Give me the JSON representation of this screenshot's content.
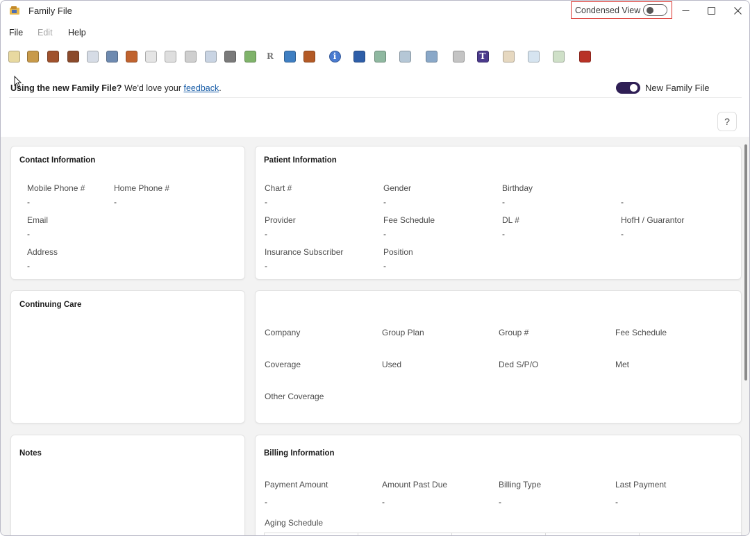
{
  "window": {
    "title": "Family File",
    "condensed_view": {
      "label": "Condensed View",
      "on": false
    },
    "controls": {
      "minimize": "–",
      "maximize": "☐",
      "close": "✕"
    }
  },
  "menu": {
    "file": "File",
    "edit": "Edit",
    "help": "Help"
  },
  "toolbar": {
    "icons": [
      {
        "name": "tooth-chart-icon",
        "color": "#e8d9a0"
      },
      {
        "name": "progress-notes-icon",
        "color": "#c89a4a"
      },
      {
        "name": "book-icon",
        "color": "#a0522d"
      },
      {
        "name": "appointment-icon",
        "color": "#8b4a2b"
      },
      {
        "name": "id-card-icon",
        "color": "#d6dce6"
      },
      {
        "name": "globe-icon",
        "color": "#6e8ab0"
      },
      {
        "name": "bandage-icon",
        "color": "#c0632f"
      },
      {
        "name": "eraser-icon",
        "color": "#e5e5e5"
      },
      {
        "name": "card-icon",
        "color": "#dedede"
      },
      {
        "name": "print-preview-icon",
        "color": "#cfcfcf"
      },
      {
        "name": "email-icon",
        "color": "#c9d4e3"
      },
      {
        "name": "document-list-icon",
        "color": "#7a7a7a"
      },
      {
        "name": "form-icon",
        "color": "#7fb36a"
      },
      {
        "name": "rx-icon",
        "color": "#ffffff",
        "glyph": "R"
      },
      {
        "name": "package-icon",
        "color": "#3f7fc2"
      },
      {
        "name": "door-icon",
        "color": "#b35a26"
      },
      {
        "name": "info-icon",
        "color": "#4a7bd0",
        "glyph": "i"
      },
      {
        "name": "patient-portal-icon",
        "color": "#2e5ea8"
      },
      {
        "name": "family-members-icon",
        "color": "#8fb8a0"
      },
      {
        "name": "referral-icon",
        "color": "#b5c7d6"
      },
      {
        "name": "chat-icon",
        "color": "#8aa8c8"
      },
      {
        "name": "scanner-icon",
        "color": "#c4c4c4"
      },
      {
        "name": "teams-icon",
        "color": "#4b3a8c",
        "glyph": "T"
      },
      {
        "name": "blank-form-icon",
        "color": "#e6d8c0"
      },
      {
        "name": "patient-icon",
        "color": "#d6e4f0"
      },
      {
        "name": "hygiene-icon",
        "color": "#cfe0c8"
      },
      {
        "name": "library-icon",
        "color": "#b83226"
      }
    ]
  },
  "feedback": {
    "bold": "Using the new Family File?",
    "text": "We'd love your",
    "link": "feedback",
    "suffix": "."
  },
  "new_family_file": {
    "label": "New Family File",
    "on": true
  },
  "help_button": "?",
  "contact": {
    "title": "Contact Information",
    "mobile_label": "Mobile Phone #",
    "mobile_value": "-",
    "home_label": "Home Phone #",
    "home_value": "-",
    "email_label": "Email",
    "email_value": "-",
    "address_label": "Address",
    "address_value": "-"
  },
  "patient": {
    "title": "Patient Information",
    "chart_label": "Chart #",
    "chart_value": "-",
    "gender_label": "Gender",
    "gender_value": "-",
    "birthday_label": "Birthday",
    "birthday_value": "-",
    "extra_value": "-",
    "provider_label": "Provider",
    "provider_value": "-",
    "fee_label": "Fee Schedule",
    "fee_value": "-",
    "dl_label": "DL #",
    "dl_value": "-",
    "hofh_label": "HofH / Guarantor",
    "hofh_value": "-",
    "insurance_label": "Insurance Subscriber",
    "insurance_value": "-",
    "position_label": "Position",
    "position_value": "-"
  },
  "continuing_care": {
    "title": "Continuing Care"
  },
  "insurance": {
    "company_label": "Company",
    "group_plan_label": "Group Plan",
    "group_num_label": "Group #",
    "fee_schedule_label": "Fee Schedule",
    "coverage_label": "Coverage",
    "used_label": "Used",
    "ded_label": "Ded S/P/O",
    "met_label": "Met",
    "other_coverage_label": "Other Coverage"
  },
  "notes": {
    "title": "Notes"
  },
  "billing": {
    "title": "Billing Information",
    "payment_label": "Payment Amount",
    "payment_value": "-",
    "past_due_label": "Amount Past Due",
    "past_due_value": "-",
    "billing_type_label": "Billing Type",
    "billing_type_value": "-",
    "last_payment_label": "Last Payment",
    "last_payment_value": "-",
    "aging_label": "Aging Schedule"
  }
}
